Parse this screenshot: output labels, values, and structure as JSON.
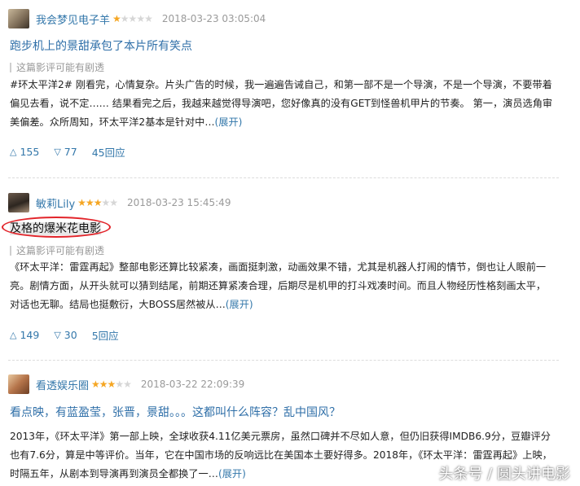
{
  "reviews": [
    {
      "username": "我会梦见电子羊",
      "rating": 1,
      "stars_total": 5,
      "time": "2018-03-23 03:05:04",
      "title": "跑步机上的景甜承包了本片所有笑点",
      "spoiler_note": "这篇影评可能有剧透",
      "body": "#环太平洋2# 刚看完，心情复杂。片头广告的时候，我一遍遍告诫自己，和第一部不是一个导演，不是一个导演，不要带着偏见去看，说不定…… 结果看完之后，我越来越觉得导演吧，您好像真的没有GET到怪兽机甲片的节奏。 第一，演员选角审美偏差。众所周知，环太平洋2基本是针对中…",
      "expand": "(展开)",
      "up": "155",
      "down": "77",
      "replies": "45回应"
    },
    {
      "username": "敏莉Lily",
      "rating": 3,
      "stars_total": 5,
      "time": "2018-03-23 15:45:49",
      "title": "及格的爆米花电影",
      "spoiler_note": "这篇影评可能有剧透",
      "body": "《环太平洋：雷霆再起》整部电影还算比较紧凑，画面挺刺激，动画效果不错，尤其是机器人打闹的情节，倒也让人眼前一亮。剧情方面，从开头就可以猜到结尾，前期还算紧凑合理，后期尽是机甲的打斗戏凑时间。而且人物经历性格刻画太平，对话也无聊。结局也挺敷衍，大BOSS居然被从…",
      "expand": "(展开)",
      "up": "149",
      "down": "30",
      "replies": "5回应"
    },
    {
      "username": "看透娱乐圈",
      "rating": 3,
      "stars_total": 5,
      "time": "2018-03-22 22:09:39",
      "title": "看点映，有蓝盈莹，张晋，景甜。。。这都叫什么阵容？乱中国风？",
      "body": "2013年，《环太平洋》第一部上映，全球收获4.11亿美元票房，虽然口碑并不尽如人意，但仍旧获得IMDB6.9分，豆瓣评分也有7.6分，算是中等评价。当年，它在中国市场的反响远比在美国本土要好得多。2018年，《环太平洋：雷霆再起》上映，时隔五年，从剧本到导演再到演员全都换了一…",
      "expand": "(展开)"
    }
  ],
  "watermark": "头条号 / 圆头讲电影",
  "colors": {
    "link": "#3377aa",
    "star_on": "#f5a623",
    "highlight_circle": "#e2242a"
  }
}
